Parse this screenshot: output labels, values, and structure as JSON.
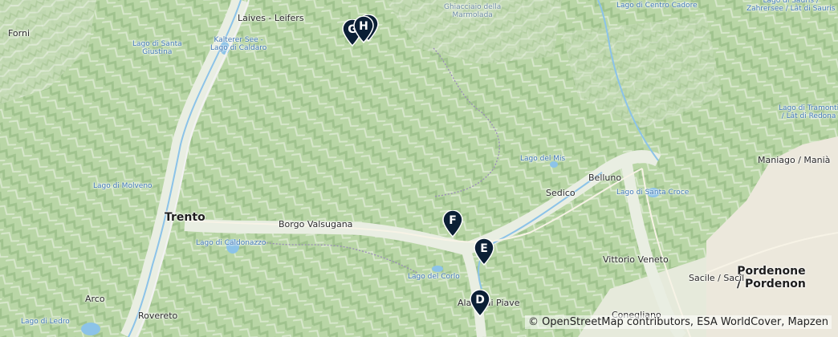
{
  "map": {
    "labels": [
      {
        "text": "Laives - Leifers",
        "kind": "town"
      },
      {
        "text": "Lago di Santa\nGiustina",
        "kind": "water"
      },
      {
        "text": "Kalterer See -\nLago di Caldaro",
        "kind": "water"
      },
      {
        "text": "Ghiacciaio della\nMarmolada",
        "kind": "glacier"
      },
      {
        "text": "Lago di Centro Cadore",
        "kind": "water"
      },
      {
        "text": "Lago di Sauris /\nZahrersee / Lât di Sauris",
        "kind": "water"
      },
      {
        "text": "Lago di Tramonti\n/ Lât di Redona",
        "kind": "water"
      },
      {
        "text": "Maniago / Manià",
        "kind": "town"
      },
      {
        "text": "Lago del Mis",
        "kind": "water"
      },
      {
        "text": "Belluno",
        "kind": "town"
      },
      {
        "text": "Sedico",
        "kind": "town"
      },
      {
        "text": "Lago di Santa Croce",
        "kind": "water"
      },
      {
        "text": "Lago di Molveno",
        "kind": "water"
      },
      {
        "text": "Trento",
        "kind": "city"
      },
      {
        "text": "Borgo Valsugana",
        "kind": "town"
      },
      {
        "text": "Lago di Caldonazzo",
        "kind": "water"
      },
      {
        "text": "Lago del Corlo",
        "kind": "water"
      },
      {
        "text": "Vittorio Veneto",
        "kind": "town"
      },
      {
        "text": "Pordenone\n/ Pordenon",
        "kind": "big"
      },
      {
        "text": "Sacile / Sacîl",
        "kind": "town"
      },
      {
        "text": "Arco",
        "kind": "town"
      },
      {
        "text": "Rovereto",
        "kind": "town"
      },
      {
        "text": "Lago di Ledro",
        "kind": "water"
      },
      {
        "text": "Conegliano",
        "kind": "town"
      },
      {
        "text": "Alano di Piave",
        "kind": "town"
      },
      {
        "text": "Forni",
        "kind": "town"
      }
    ],
    "markers": [
      "H",
      "G",
      "F",
      "E",
      "D"
    ],
    "attribution": "© OpenStreetMap contributors, ESA WorldCover, Mapzen",
    "colors": {
      "marker": "#0b1f35",
      "water": "#8cc3e8",
      "forest": "#a9cc98",
      "valley": "#e8ece0",
      "plain": "#ece8dc"
    }
  }
}
